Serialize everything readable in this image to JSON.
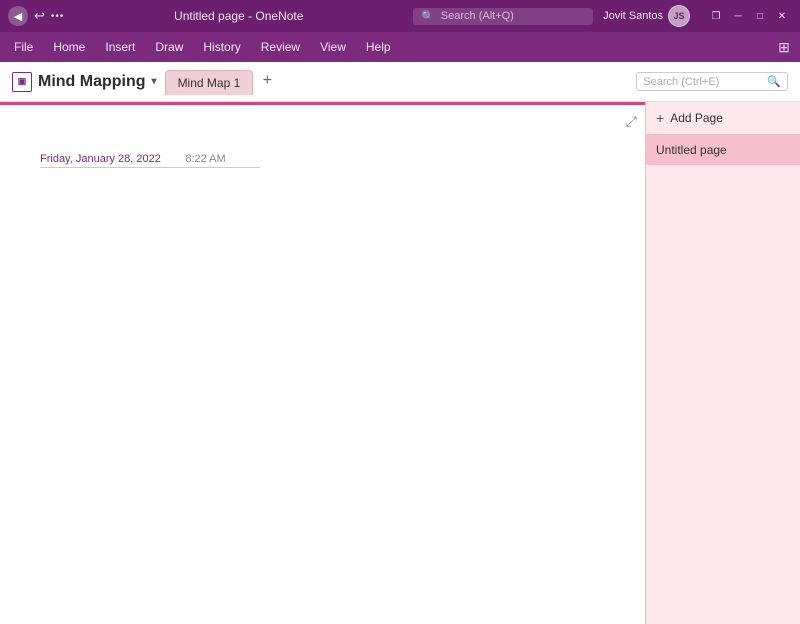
{
  "titlebar": {
    "back_icon": "◀",
    "undo_icon": "↩",
    "more_icon": "•••",
    "title": "Untitled page - OneNote",
    "search_placeholder": "Search (Alt+Q)",
    "user_name": "Jovit Santos",
    "user_initials": "JS",
    "restore_icon": "❐",
    "minimize_icon": "─",
    "maximize_icon": "□",
    "close_icon": "✕"
  },
  "menubar": {
    "items": [
      "File",
      "Home",
      "Insert",
      "Draw",
      "History",
      "Review",
      "View",
      "Help"
    ],
    "sidebar_icon": "⊞"
  },
  "notebook": {
    "name": "Mind Mapping",
    "icon": "⊞",
    "chevron": "▾"
  },
  "tabs": [
    {
      "label": "Mind Map 1",
      "active": true
    }
  ],
  "tab_add_icon": "+",
  "header_search": {
    "placeholder": "Search (Ctrl+E)",
    "search_icon": "🔍"
  },
  "page": {
    "date": "Friday, January 28, 2022",
    "time": "8:22 AM",
    "expand_icon": "⤢"
  },
  "right_panel": {
    "add_page_label": "Add Page",
    "add_icon": "+",
    "pages": [
      {
        "label": "Untitled page",
        "selected": true
      }
    ]
  }
}
